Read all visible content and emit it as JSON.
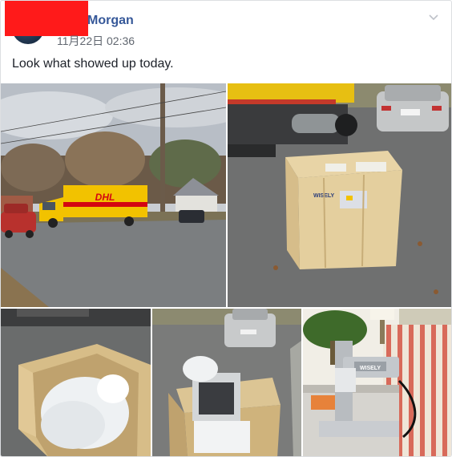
{
  "post": {
    "author": "Morgan",
    "timestamp": "11月22日 02:36",
    "text": "Look what showed up today."
  },
  "photos": {
    "truck_logo": "DHL",
    "crate_brand": "WISELY",
    "crate_brand_small": "WISELY",
    "machine_brand": "WISELY"
  },
  "colors": {
    "author_link": "#365899",
    "redaction": "#ff1a1a"
  }
}
